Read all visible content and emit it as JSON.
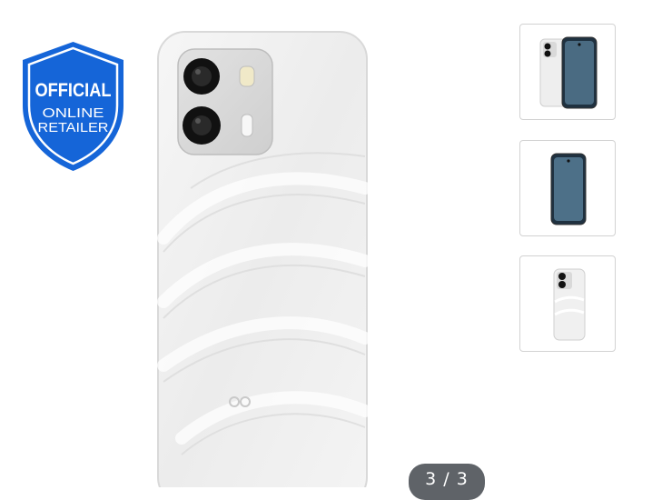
{
  "badge": {
    "line1": "OFFICIAL",
    "line2": "ONLINE",
    "line3": "RETAILER",
    "color": "#1565d8"
  },
  "gallery": {
    "counter": "3 / 3",
    "current_index": 3,
    "total": 3,
    "main_image": "phone-back-white",
    "thumbnails": [
      {
        "icon": "phone-front-and-back"
      },
      {
        "icon": "phone-front"
      },
      {
        "icon": "phone-back"
      }
    ]
  },
  "colors": {
    "phone_body": "#f1f1f1",
    "screen": "#1f3140",
    "counter_bg": "#5f6368",
    "thumb_border": "#d2d2d2"
  }
}
